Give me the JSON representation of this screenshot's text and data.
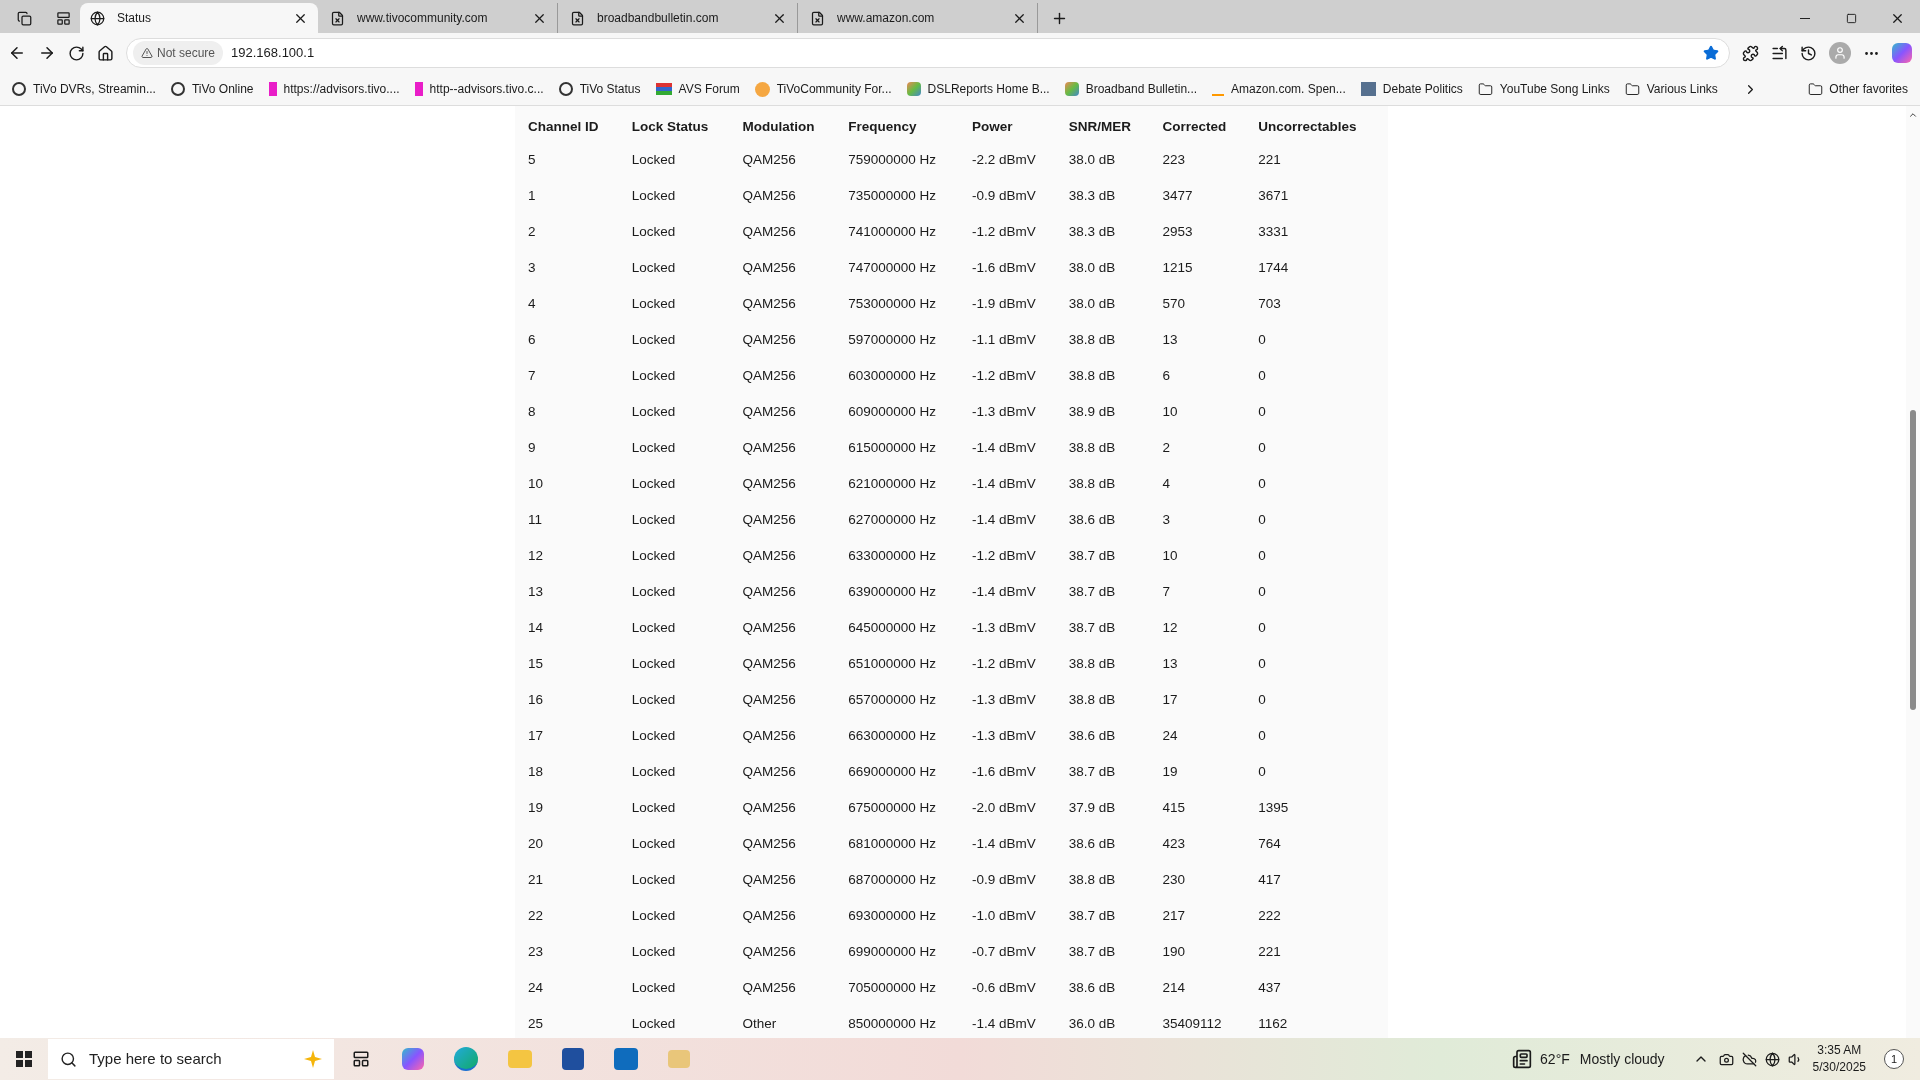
{
  "tabs": [
    {
      "label": "Status",
      "selected": true,
      "kind": "globe"
    },
    {
      "label": "www.tivocommunity.com",
      "selected": false,
      "kind": "page"
    },
    {
      "label": "broadbandbulletin.com",
      "selected": false,
      "kind": "page"
    },
    {
      "label": "www.amazon.com",
      "selected": false,
      "kind": "page"
    }
  ],
  "address_bar": {
    "security": "Not secure",
    "url": "192.168.100.1",
    "favorite": true
  },
  "bookmarks": [
    {
      "label": "TiVo DVRs, Streamin...",
      "kind": "tivo"
    },
    {
      "label": "TiVo Online",
      "kind": "tivo"
    },
    {
      "label": "https://advisors.tivo....",
      "kind": "pink"
    },
    {
      "label": "http--advisors.tivo.c...",
      "kind": "pink"
    },
    {
      "label": "TiVo Status",
      "kind": "tivo"
    },
    {
      "label": "AVS Forum",
      "kind": "stripes"
    },
    {
      "label": "TiVoCommunity For...",
      "kind": "circle"
    },
    {
      "label": "DSLReports Home B...",
      "kind": "puzzle"
    },
    {
      "label": "Broadband Bulletin...",
      "kind": "puzzle"
    },
    {
      "label": "Amazon.com. Spen...",
      "kind": "amazon"
    },
    {
      "label": "Debate Politics",
      "kind": "photo"
    },
    {
      "label": "YouTube Song Links",
      "kind": "folder"
    },
    {
      "label": "Various Links",
      "kind": "folder"
    }
  ],
  "other_favorites": "Other favorites",
  "table": {
    "columns": [
      "Channel ID",
      "Lock Status",
      "Modulation",
      "Frequency",
      "Power",
      "SNR/MER",
      "Corrected",
      "Uncorrectables"
    ],
    "rows": [
      [
        "5",
        "Locked",
        "QAM256",
        "759000000 Hz",
        "-2.2 dBmV",
        "38.0 dB",
        "223",
        "221"
      ],
      [
        "1",
        "Locked",
        "QAM256",
        "735000000 Hz",
        "-0.9 dBmV",
        "38.3 dB",
        "3477",
        "3671"
      ],
      [
        "2",
        "Locked",
        "QAM256",
        "741000000 Hz",
        "-1.2 dBmV",
        "38.3 dB",
        "2953",
        "3331"
      ],
      [
        "3",
        "Locked",
        "QAM256",
        "747000000 Hz",
        "-1.6 dBmV",
        "38.0 dB",
        "1215",
        "1744"
      ],
      [
        "4",
        "Locked",
        "QAM256",
        "753000000 Hz",
        "-1.9 dBmV",
        "38.0 dB",
        "570",
        "703"
      ],
      [
        "6",
        "Locked",
        "QAM256",
        "597000000 Hz",
        "-1.1 dBmV",
        "38.8 dB",
        "13",
        "0"
      ],
      [
        "7",
        "Locked",
        "QAM256",
        "603000000 Hz",
        "-1.2 dBmV",
        "38.8 dB",
        "6",
        "0"
      ],
      [
        "8",
        "Locked",
        "QAM256",
        "609000000 Hz",
        "-1.3 dBmV",
        "38.9 dB",
        "10",
        "0"
      ],
      [
        "9",
        "Locked",
        "QAM256",
        "615000000 Hz",
        "-1.4 dBmV",
        "38.8 dB",
        "2",
        "0"
      ],
      [
        "10",
        "Locked",
        "QAM256",
        "621000000 Hz",
        "-1.4 dBmV",
        "38.8 dB",
        "4",
        "0"
      ],
      [
        "11",
        "Locked",
        "QAM256",
        "627000000 Hz",
        "-1.4 dBmV",
        "38.6 dB",
        "3",
        "0"
      ],
      [
        "12",
        "Locked",
        "QAM256",
        "633000000 Hz",
        "-1.2 dBmV",
        "38.7 dB",
        "10",
        "0"
      ],
      [
        "13",
        "Locked",
        "QAM256",
        "639000000 Hz",
        "-1.4 dBmV",
        "38.7 dB",
        "7",
        "0"
      ],
      [
        "14",
        "Locked",
        "QAM256",
        "645000000 Hz",
        "-1.3 dBmV",
        "38.7 dB",
        "12",
        "0"
      ],
      [
        "15",
        "Locked",
        "QAM256",
        "651000000 Hz",
        "-1.2 dBmV",
        "38.8 dB",
        "13",
        "0"
      ],
      [
        "16",
        "Locked",
        "QAM256",
        "657000000 Hz",
        "-1.3 dBmV",
        "38.8 dB",
        "17",
        "0"
      ],
      [
        "17",
        "Locked",
        "QAM256",
        "663000000 Hz",
        "-1.3 dBmV",
        "38.6 dB",
        "24",
        "0"
      ],
      [
        "18",
        "Locked",
        "QAM256",
        "669000000 Hz",
        "-1.6 dBmV",
        "38.7 dB",
        "19",
        "0"
      ],
      [
        "19",
        "Locked",
        "QAM256",
        "675000000 Hz",
        "-2.0 dBmV",
        "37.9 dB",
        "415",
        "1395"
      ],
      [
        "20",
        "Locked",
        "QAM256",
        "681000000 Hz",
        "-1.4 dBmV",
        "38.6 dB",
        "423",
        "764"
      ],
      [
        "21",
        "Locked",
        "QAM256",
        "687000000 Hz",
        "-0.9 dBmV",
        "38.8 dB",
        "230",
        "417"
      ],
      [
        "22",
        "Locked",
        "QAM256",
        "693000000 Hz",
        "-1.0 dBmV",
        "38.7 dB",
        "217",
        "222"
      ],
      [
        "23",
        "Locked",
        "QAM256",
        "699000000 Hz",
        "-0.7 dBmV",
        "38.7 dB",
        "190",
        "221"
      ],
      [
        "24",
        "Locked",
        "QAM256",
        "705000000 Hz",
        "-0.6 dBmV",
        "38.6 dB",
        "214",
        "437"
      ],
      [
        "25",
        "Locked",
        "Other",
        "850000000 Hz",
        "-1.4 dBmV",
        "36.0 dB",
        "35409112",
        "1162"
      ]
    ]
  },
  "taskbar": {
    "search_placeholder": "Type here to search",
    "weather": "62°F",
    "weather_text": "Mostly cloudy",
    "time": "3:35 AM",
    "date": "5/30/2025",
    "notifications": "1"
  }
}
